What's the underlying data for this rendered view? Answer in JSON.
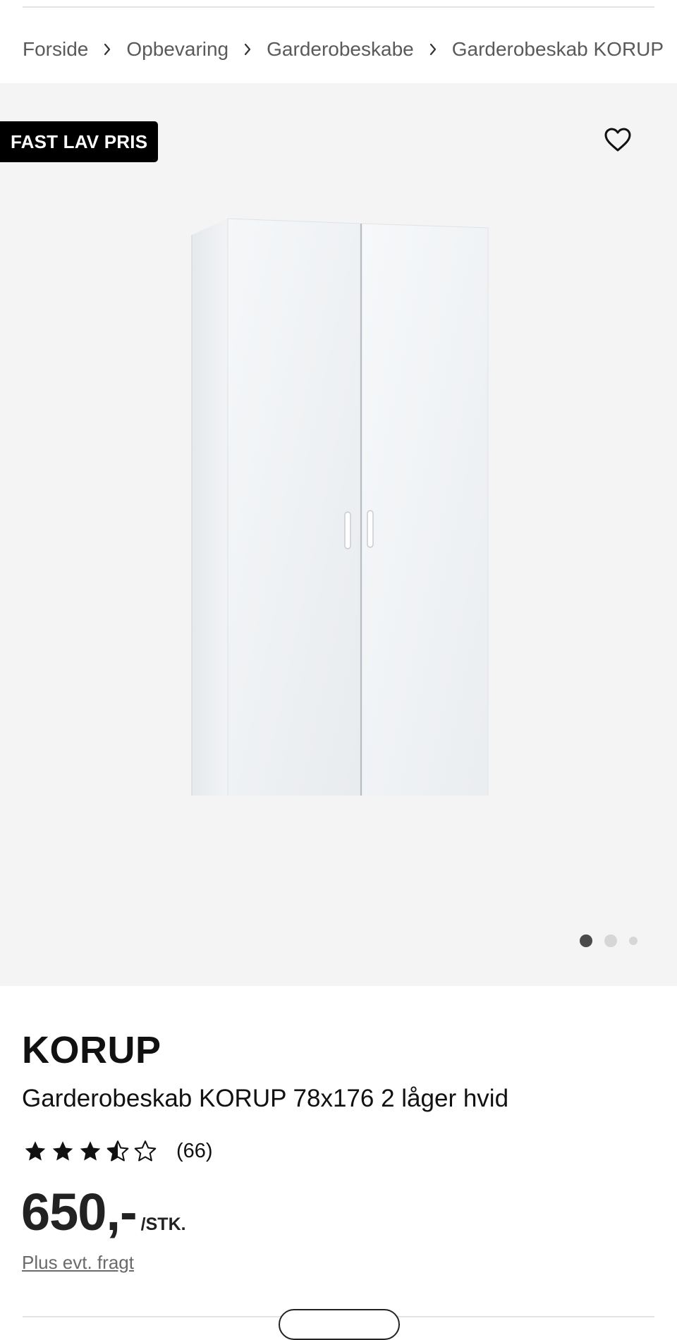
{
  "breadcrumb": {
    "items": [
      "Forside",
      "Opbevaring",
      "Garderobeskabe",
      "Garderobeskab KORUP"
    ]
  },
  "gallery": {
    "badge": "FAST LAV PRIS",
    "favorite_icon": "heart-outline-icon",
    "image_count": 3,
    "active_index": 0
  },
  "product": {
    "brand": "KORUP",
    "name": "Garderobeskab KORUP 78x176 2 låger hvid",
    "rating": 3.5,
    "rating_max": 5,
    "reviews": "(66)",
    "price": "650,-",
    "unit": "/STK.",
    "freight": "Plus evt. fragt"
  },
  "colors": {
    "badge_bg": "#000000",
    "gallery_bg": "#f4f4f4",
    "dot_active": "#4a4a4a",
    "dot_inactive": "#d6d6d6"
  }
}
